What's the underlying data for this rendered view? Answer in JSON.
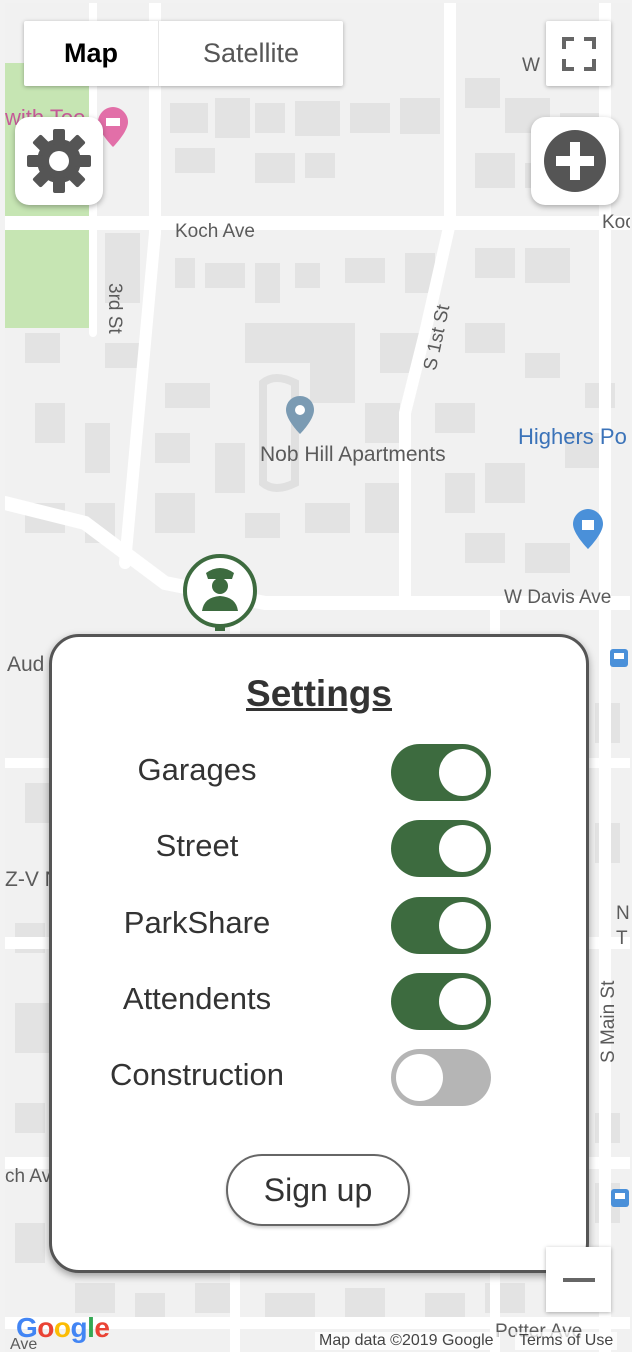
{
  "map_type": {
    "map_label": "Map",
    "satellite_label": "Satellite"
  },
  "map_labels": {
    "koch_ave": "Koch Ave",
    "koch_ave_right": "Koc",
    "w_davis_ave": "W Davis Ave",
    "third_st": "3rd St",
    "s_first_st": "S 1st St",
    "nob_hill": "Nob Hill Apartments",
    "highers": "Highers Po",
    "s_main_st": "S Main St",
    "potter_ave": "Potter Ave",
    "w_top": "W",
    "with_too": "with Too",
    "aud": "Aud",
    "zv": "Z-V N",
    "ch_av": "ch Av",
    "ave_bottom": "Ave",
    "n_right": "N",
    "t_right": "T"
  },
  "settings": {
    "title": "Settings",
    "items": [
      {
        "label": "Garages",
        "enabled": true
      },
      {
        "label": "Street",
        "enabled": true
      },
      {
        "label": "ParkShare",
        "enabled": true
      },
      {
        "label": "Attendents",
        "enabled": true
      },
      {
        "label": "Construction",
        "enabled": false
      }
    ],
    "signup_label": "Sign up"
  },
  "attribution": {
    "map_data": "Map data ©2019 Google",
    "terms": "Terms of Use"
  },
  "logo": "Google",
  "colors": {
    "accent_green": "#3d6b3f",
    "toggle_off": "#b5b5b5",
    "panel_border": "#555555"
  },
  "icons": [
    "gear-icon",
    "plus-icon",
    "fullscreen-icon",
    "attendant-icon",
    "minus-icon",
    "place-pin-icon",
    "shopping-pin-icon",
    "hotel-pin-icon",
    "bus-stop-icon"
  ]
}
